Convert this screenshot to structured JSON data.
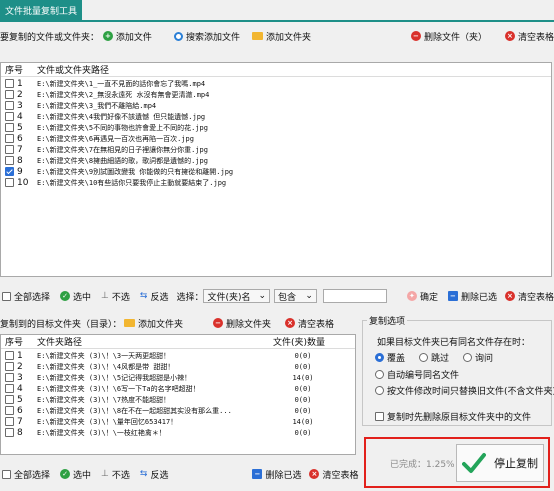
{
  "app": {
    "tab_label": "文件批量复制工具"
  },
  "source": {
    "section_label": "要复制的文件或文件夹：",
    "add_file": "添加文件",
    "search_add_file": "搜索添加文件",
    "add_folder": "添加文件夹",
    "delete_file": "删除文件（夹）",
    "clear_table": "清空表格",
    "col_index": "序号",
    "col_path": "文件或文件夹路径",
    "rows": [
      {
        "n": "1",
        "path": "E:\\新建文件夹\\1_一直不見面的話你會忘了我嗎.mp4",
        "checked": false
      },
      {
        "n": "2",
        "path": "E:\\新建文件夹\\2_無沒永遠死 水沒有無會更清澈.mp4",
        "checked": false
      },
      {
        "n": "3",
        "path": "E:\\新建文件夹\\3_我們不離陪給.mp4",
        "checked": false
      },
      {
        "n": "4",
        "path": "E:\\新建文件夹\\4我們好像不該遺憾 但只能遺憾.jpg",
        "checked": false
      },
      {
        "n": "5",
        "path": "E:\\新建文件夹\\5不同的事物也許會愛上不同的花.jpg",
        "checked": false
      },
      {
        "n": "6",
        "path": "E:\\新建文件夹\\6再遇見一百次也再陷一百次.jpg",
        "checked": false
      },
      {
        "n": "7",
        "path": "E:\\新建文件夹\\7在無相見的日子裡讓你無分你重.jpg",
        "checked": false
      },
      {
        "n": "8",
        "path": "E:\\新建文件夹\\8擁曲細語的歌，歌詞都是遺憾的.jpg",
        "checked": false
      },
      {
        "n": "9",
        "path": "E:\\新建文件夹\\9別試圖改變我 你能做的只有擁從和離開.jpg",
        "checked": true
      },
      {
        "n": "10",
        "path": "E:\\新建文件夹\\10有些話你只要我停止主動就要結束了.jpg",
        "checked": false
      }
    ]
  },
  "toolbar2": {
    "select_all": "全部选择",
    "select": "选中",
    "deselect": "不选",
    "invert": "反选",
    "select_label": "选择：",
    "filter_field": "文件(夹)名",
    "filter_op": "包含",
    "filter_value": "",
    "confirm": "确定",
    "delete_selected": "删除已选",
    "clear_table": "清空表格"
  },
  "target": {
    "section_label": "复制到的目标文件夹（目录）：",
    "add_folder": "添加文件夹",
    "delete_folder": "删除文件夹",
    "clear_table": "清空表格",
    "col_index": "序号",
    "col_path": "文件夹路径",
    "col_count": "文件(夹)数量",
    "rows": [
      {
        "n": "1",
        "path": "E:\\新建文件夹 (3)\\！\\3一天两更超甜！",
        "count": "0(0)"
      },
      {
        "n": "2",
        "path": "E:\\新建文件夹 (3)\\！\\4风都是带  甜甜！",
        "count": "0(0)"
      },
      {
        "n": "3",
        "path": "E:\\新建文件夹 (3)\\！\\5记记得我超甜是小辣！",
        "count": "14(0)"
      },
      {
        "n": "4",
        "path": "E:\\新建文件夹 (3)\\！\\6写一下Ta的名字吧超甜！",
        "count": "0(0)"
      },
      {
        "n": "5",
        "path": "E:\\新建文件夹 (3)\\！\\7热度不能超甜！",
        "count": "0(0)"
      },
      {
        "n": "6",
        "path": "E:\\新建文件夹 (3)\\！\\8在不在一起超甜其实没有那么重...",
        "count": "0(0)"
      },
      {
        "n": "7",
        "path": "E:\\新建文件夹 (3)\\！\\量年回忆653417！",
        "count": "14(0)"
      },
      {
        "n": "8",
        "path": "E:\\新建文件夹 (3)\\！\\一枝红艳禽＊！",
        "count": "0(0)"
      }
    ],
    "select_all": "全部选择",
    "select": "选中",
    "deselect": "不选",
    "invert": "反选",
    "delete_selected": "删除已选",
    "clear_table2": "清空表格"
  },
  "options": {
    "title": "复制选项",
    "prompt": "如果目标文件夹已有同名文件存在时：",
    "opt_overwrite": "覆盖",
    "opt_skip": "跳过",
    "opt_ask": "询问",
    "opt_auto_rename": "自动编号同名文件",
    "opt_by_time": "按文件修改时间只替换旧文件(不含文件夹)",
    "delete_before": "复制时先删除原目标文件夹中的文件",
    "selected_option": "覆盖"
  },
  "progress": {
    "label": "已完成：",
    "value_text": "1.25%",
    "value": 0.0125,
    "stop_button": "停止复制"
  },
  "colors": {
    "accent": "#1e8f88",
    "highlight_border": "#e2201b",
    "check_blue": "#2b6fd6"
  }
}
